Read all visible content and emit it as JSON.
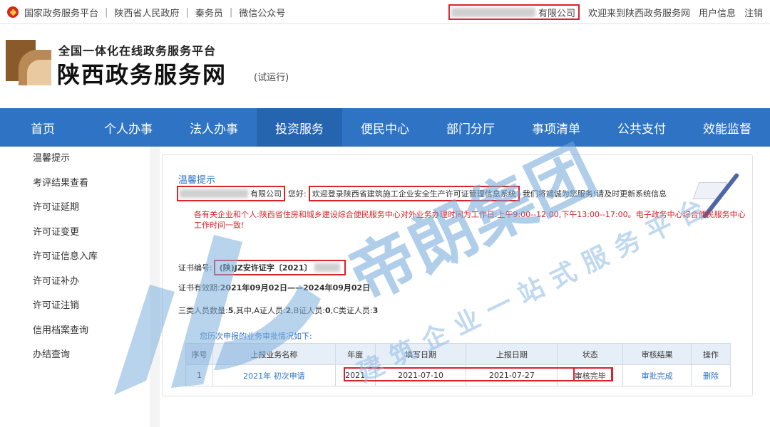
{
  "topbar": {
    "links": [
      "国家政务服务平台",
      "陕西省人民政府",
      "秦务员",
      "微信公众号"
    ],
    "company_suffix": "有限公司",
    "welcome": "欢迎来到陕西政务服务网",
    "user_info": "用户信息",
    "logout": "注销"
  },
  "header": {
    "subtitle": "全国一体化在线政务服务平台",
    "title": "陕西政务服务网",
    "trial": "(试运行)"
  },
  "nav": {
    "items": [
      "首页",
      "个人办事",
      "法人办事",
      "投资服务",
      "便民中心",
      "部门分厅",
      "事项清单",
      "公共支付",
      "效能监督"
    ],
    "active_index": 3
  },
  "sidebar": {
    "items": [
      "温馨提示",
      "考评结果查看",
      "许可证延期",
      "许可证变更",
      "许可证信息入库",
      "许可证补办",
      "许可证注销",
      "信用档案查询",
      "办结查询"
    ]
  },
  "panel": {
    "warm_title": "温馨提示",
    "company_suffix": "有限公司",
    "hello": "您好:",
    "system_welcome": "欢迎登录陕西省建筑施工企业安全生产许可证管理信息系统",
    "service_tail": "我们将竭诚为您服务!请及时更新系统信息",
    "notice": "各有关企业和个人:陕西省住房和城乡建设综合便民服务中心对外业务办理时间为工作日:上午9:00--12:00,下午13:00--17:00。电子政务中心综合便民服务中心工作时间一致!",
    "cert_label": "证书编号:",
    "cert_value": "(陕)JZ安许证字〔2021〕",
    "valid_label": "证书有效期:",
    "valid_value": "2021年09月02日——2024年09月02日",
    "persons_text_1": "三类人员数量:",
    "persons_total": "5",
    "persons_text_2": ",其中,A证人员:",
    "persons_a": "2",
    "persons_text_3": ",B证人员:",
    "persons_b": "0",
    "persons_text_4": ",C类证人员:",
    "persons_c": "3",
    "history_title": "您历次申报的业务审批情况如下:",
    "table": {
      "headers": [
        "序号",
        "上报业务名称",
        "年度",
        "填写日期",
        "上报日期",
        "状态",
        "审核结果",
        "操作"
      ],
      "rows": [
        [
          "1",
          "2021年 初次申请",
          "2021",
          "2021-07-10",
          "2021-07-27",
          "审核完毕",
          "审批完成",
          "删除"
        ]
      ]
    }
  },
  "watermark": {
    "brand": "帝朗集团",
    "slogan": "建筑企业一站式服务平台"
  },
  "colors": {
    "nav_blue": "#2f74c4",
    "highlight_red": "#d9222a",
    "link_blue": "#2f74c4"
  }
}
